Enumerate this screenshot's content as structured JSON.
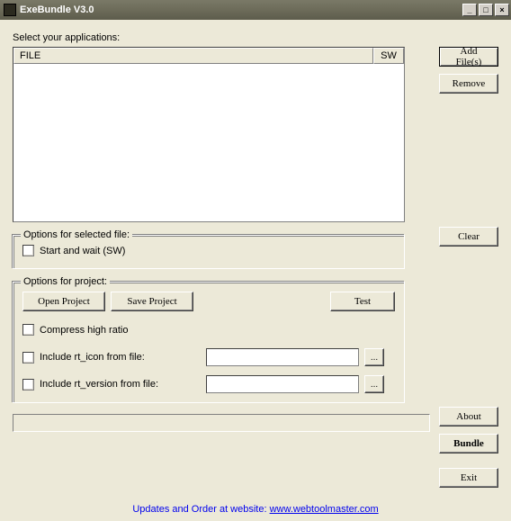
{
  "title": "ExeBundle V3.0",
  "main_label": "Select your applications:",
  "columns": {
    "file": "FILE",
    "sw": "SW"
  },
  "buttons": {
    "add_files": "Add File(s)",
    "remove": "Remove",
    "clear": "Clear",
    "about": "About",
    "bundle": "Bundle",
    "exit": "Exit",
    "open_project": "Open Project",
    "save_project": "Save Project",
    "test": "Test",
    "browse": "..."
  },
  "groups": {
    "selected_file": "Options for selected file:",
    "project": "Options for project:"
  },
  "checks": {
    "start_wait": "Start and wait (SW)",
    "compress": "Compress high ratio",
    "rt_icon": "Include rt_icon from file:",
    "rt_version": "Include rt_version from file:"
  },
  "inputs": {
    "rt_icon_value": "",
    "rt_version_value": ""
  },
  "footer": {
    "prefix": "Updates and Order at website: ",
    "link": "www.webtoolmaster.com"
  }
}
